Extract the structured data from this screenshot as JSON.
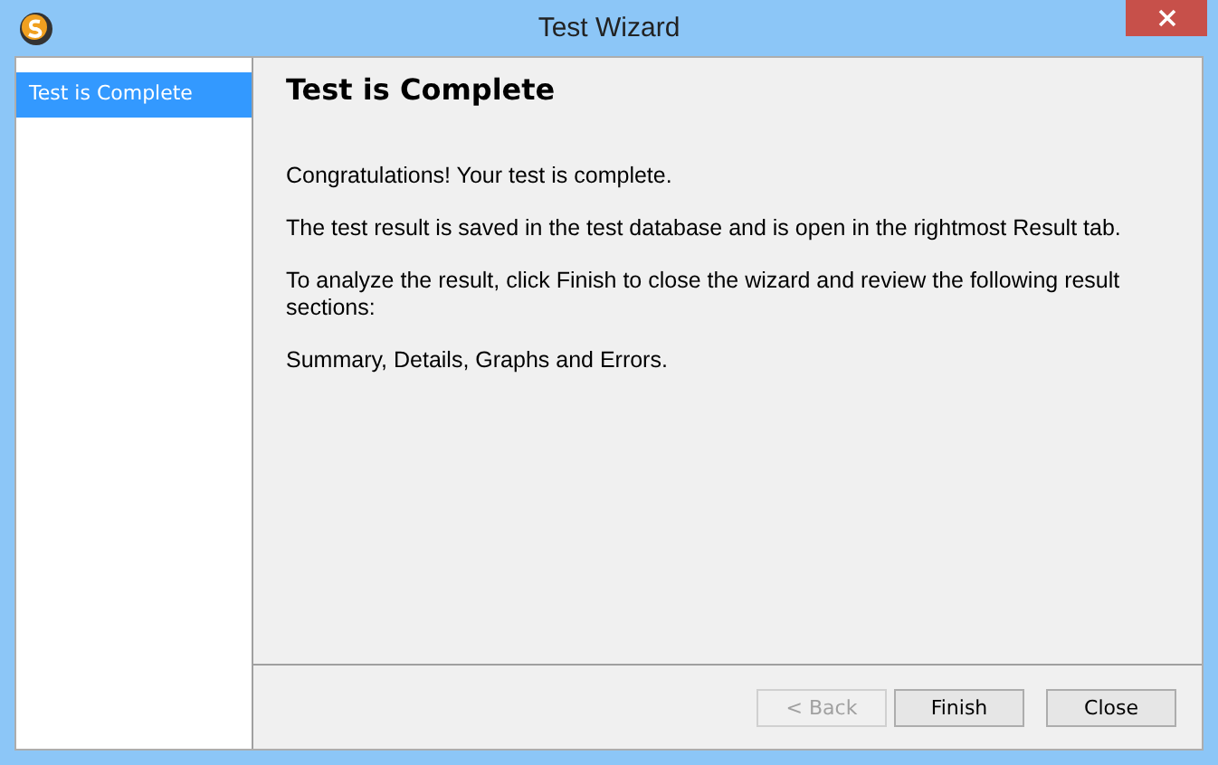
{
  "window": {
    "title": "Test Wizard"
  },
  "sidebar": {
    "items": [
      {
        "label": "Test is Complete",
        "selected": true
      }
    ]
  },
  "page": {
    "heading": "Test is Complete",
    "paragraphs": [
      "Congratulations! Your test is complete.",
      "The test result is saved in the test database and is open in the rightmost Result tab.",
      "To analyze the result, click Finish to close the wizard and review the following result sections:",
      "Summary, Details, Graphs and Errors."
    ]
  },
  "buttons": [
    {
      "label": "< Back",
      "disabled": true
    },
    {
      "label": "Finish",
      "disabled": false
    },
    {
      "label": "Close",
      "disabled": false
    }
  ]
}
